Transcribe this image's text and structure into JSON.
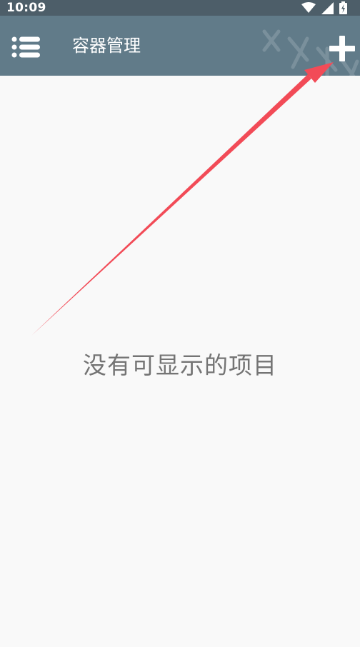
{
  "status_bar": {
    "time": "10:09",
    "icons": [
      "wifi-icon",
      "signal-icon",
      "battery-charging-icon"
    ]
  },
  "app_bar": {
    "menu_icon": "list-menu-icon",
    "title": "容器管理",
    "add_icon": "plus-icon"
  },
  "content": {
    "empty_message": "没有可显示的项目"
  },
  "annotation": {
    "arrow_color": "#f24b57",
    "points_to": "add-button"
  },
  "colors": {
    "status_bar_bg": "#4d5e69",
    "app_bar_bg": "#617b89",
    "page_bg": "#f9f9f9",
    "empty_text": "#747474"
  }
}
